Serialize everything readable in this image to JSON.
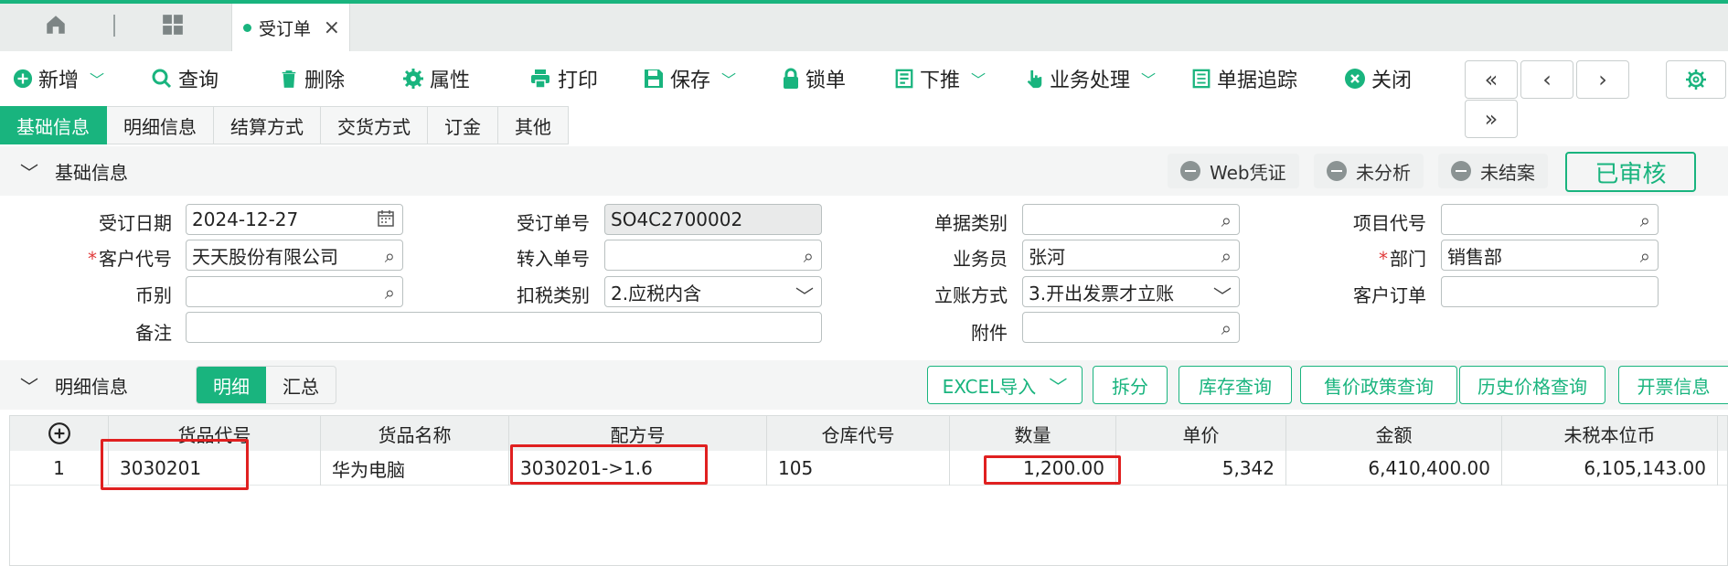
{
  "tab": {
    "title": "受订单"
  },
  "toolbar": {
    "new": "新增",
    "query": "查询",
    "delete": "删除",
    "properties": "属性",
    "print": "打印",
    "save": "保存",
    "lock": "锁单",
    "push_down": "下推",
    "business": "业务处理",
    "trace": "单据追踪",
    "close": "关闭"
  },
  "subtabs": [
    "基础信息",
    "明细信息",
    "结算方式",
    "交货方式",
    "订金",
    "其他"
  ],
  "basic_section": {
    "title": "基础信息",
    "pills": [
      "Web凭证",
      "未分析",
      "未结案"
    ],
    "status": "已审核"
  },
  "form": {
    "order_date": {
      "label": "受订日期",
      "value": "2024-12-27"
    },
    "order_no": {
      "label": "受订单号",
      "value": "SO4C2700002"
    },
    "doc_type": {
      "label": "单据类别",
      "value": ""
    },
    "project_code": {
      "label": "项目代号",
      "value": ""
    },
    "customer_code": {
      "label": "客户代号",
      "value": "天天股份有限公司"
    },
    "transfer_no": {
      "label": "转入单号",
      "value": ""
    },
    "salesman": {
      "label": "业务员",
      "value": "张河"
    },
    "department": {
      "label": "部门",
      "value": "销售部"
    },
    "currency": {
      "label": "币别",
      "value": ""
    },
    "tax_type": {
      "label": "扣税类别",
      "value": "2.应税内含"
    },
    "account_method": {
      "label": "立账方式",
      "value": "3.开出发票才立账"
    },
    "customer_order": {
      "label": "客户订单",
      "value": ""
    },
    "remark": {
      "label": "备注",
      "value": ""
    },
    "attachment": {
      "label": "附件",
      "value": ""
    }
  },
  "detail_section": {
    "title": "明细信息",
    "views": [
      "明细",
      "汇总"
    ],
    "buttons": [
      "EXCEL导入",
      "拆分",
      "库存查询",
      "售价政策查询",
      "历史价格查询",
      "开票信息"
    ]
  },
  "grid": {
    "columns": [
      "货品代号",
      "货品名称",
      "配方号",
      "仓库代号",
      "数量",
      "单价",
      "金额",
      "未税本位币"
    ],
    "rows": [
      {
        "idx": "1",
        "item_code": "3030201",
        "item_name": "华为电脑",
        "formula": "3030201->1.6",
        "warehouse": "105",
        "qty": "1,200.00",
        "price": "5,342",
        "amount": "6,410,400.00",
        "untaxed": "6,105,143.00"
      }
    ]
  },
  "colors": {
    "accent": "#19b47e",
    "highlight": "#e02020"
  }
}
